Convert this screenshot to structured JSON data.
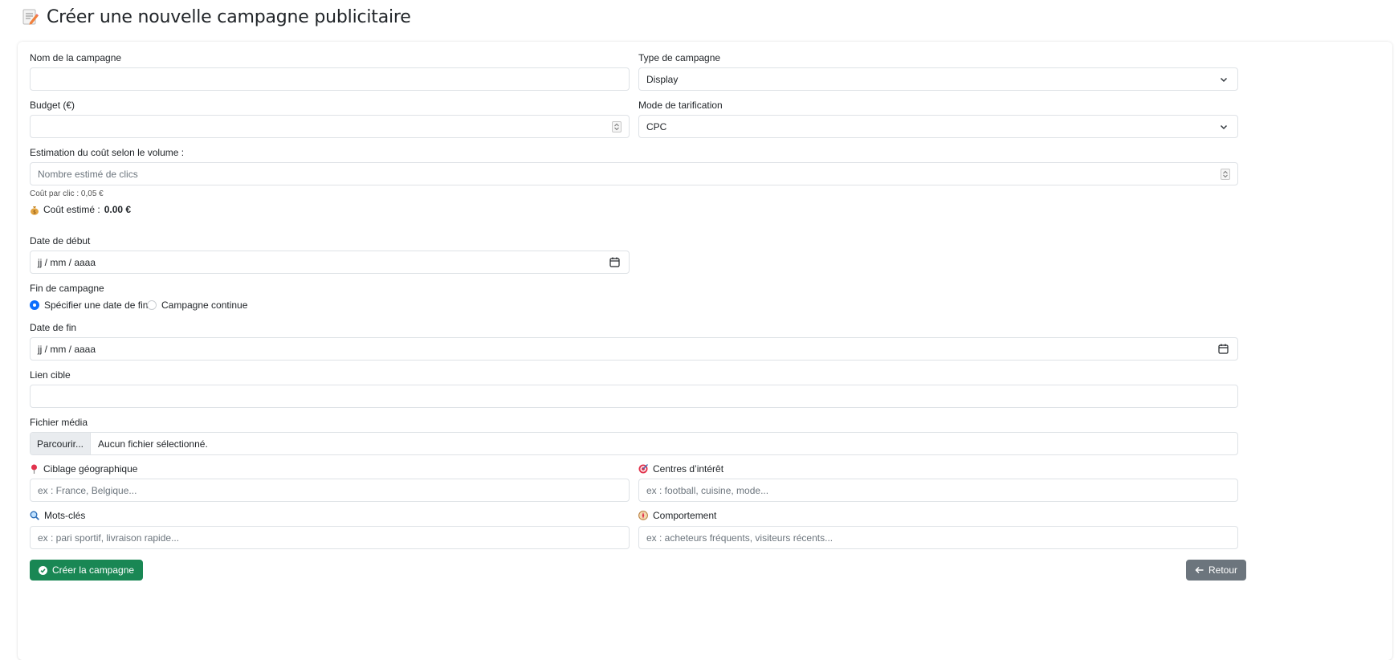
{
  "header": {
    "title": "Créer une nouvelle campagne publicitaire",
    "icon": "memo-icon"
  },
  "form": {
    "name": {
      "label": "Nom de la campagne",
      "value": ""
    },
    "type": {
      "label": "Type de campagne",
      "value": "Display"
    },
    "budget": {
      "label": "Budget (€)",
      "value": ""
    },
    "pricing": {
      "label": "Mode de tarification",
      "value": "CPC"
    },
    "estimation": {
      "label": "Estimation du coût selon le volume :",
      "placeholder": "Nombre estimé de clics",
      "hint": "Coût par clic : 0,05 €",
      "result_label": "Coût estimé :",
      "result_value": "0.00 €"
    },
    "start_date": {
      "label": "Date de début",
      "value": "jj / mm / aaaa"
    },
    "end": {
      "label": "Fin de campagne",
      "option_specify": "Spécifier une date de fin",
      "option_continuous": "Campagne continue",
      "selected": "specify"
    },
    "end_date": {
      "label": "Date de fin",
      "value": "jj / mm / aaaa"
    },
    "target_link": {
      "label": "Lien cible",
      "value": ""
    },
    "media": {
      "label": "Fichier média",
      "browse": "Parcourir...",
      "status": "Aucun fichier sélectionné."
    },
    "geo": {
      "label": "Ciblage géographique",
      "placeholder": "ex : France, Belgique..."
    },
    "interests": {
      "label": "Centres d’intérêt",
      "placeholder": "ex : football, cuisine, mode..."
    },
    "keywords": {
      "label": "Mots-clés",
      "placeholder": "ex : pari sportif, livraison rapide..."
    },
    "behavior": {
      "label": "Comportement",
      "placeholder": "ex : acheteurs fréquents, visiteurs récents..."
    }
  },
  "actions": {
    "create": "Créer la campagne",
    "back": "Retour"
  },
  "colors": {
    "primary": "#0d6efd",
    "success": "#198754",
    "secondary": "#6c757d",
    "border": "#dee2e6"
  }
}
